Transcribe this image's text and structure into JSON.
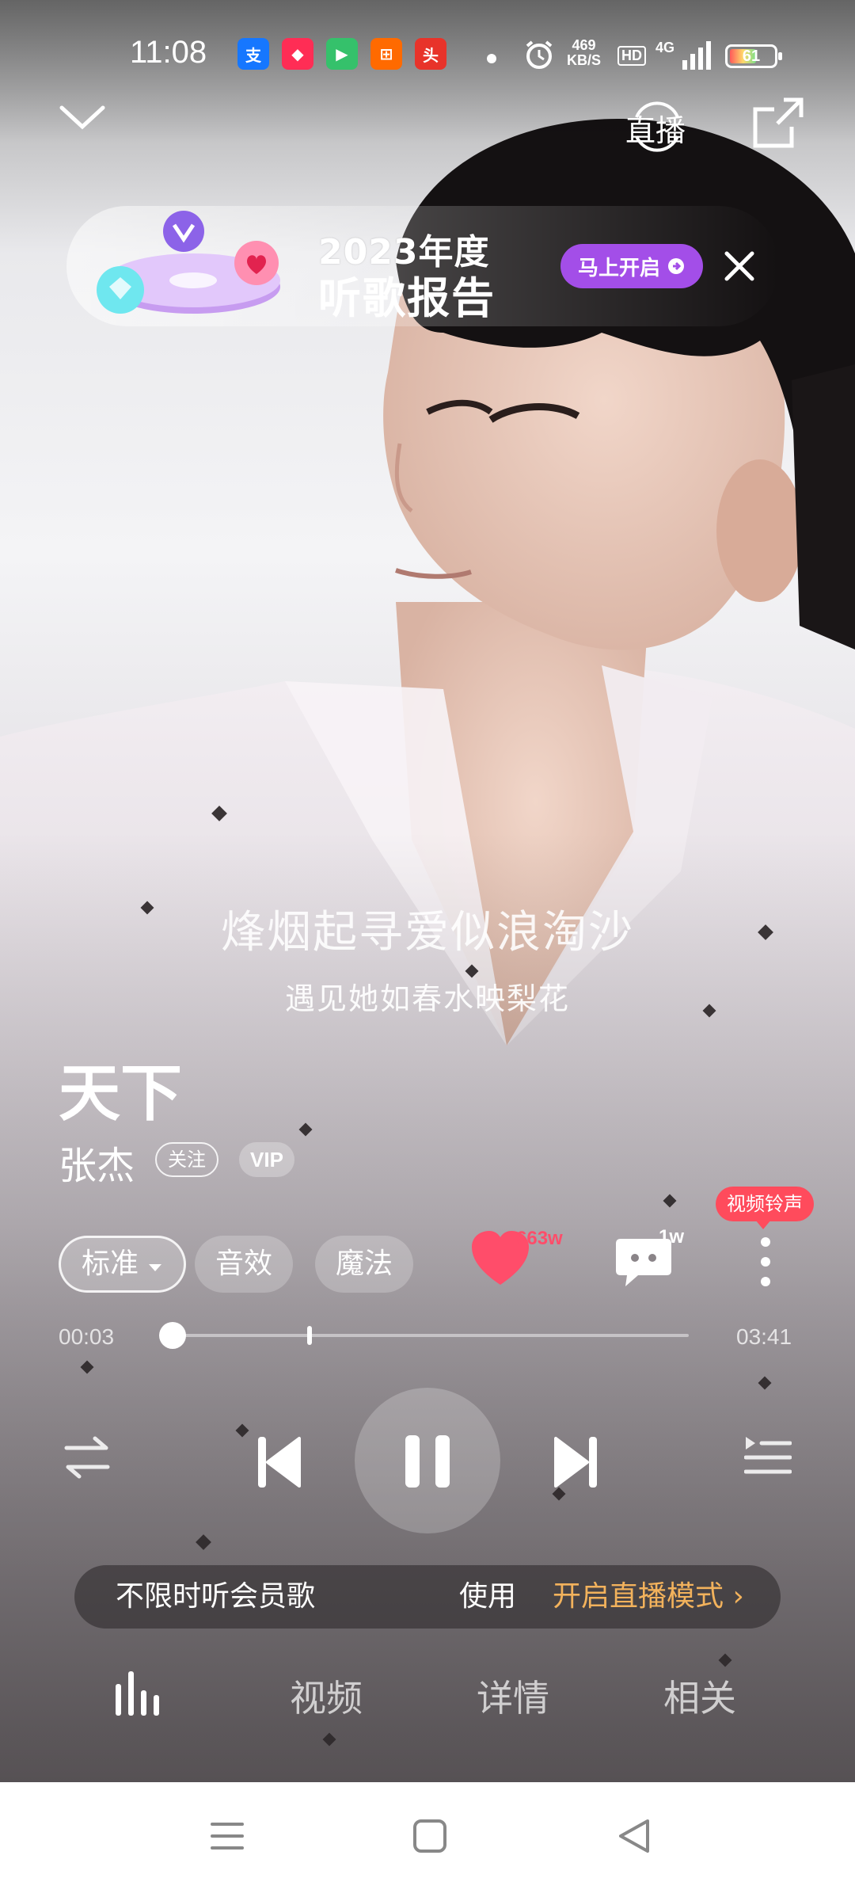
{
  "status_bar": {
    "time": "11:08",
    "net_speed_value": "469",
    "net_speed_unit": "KB/S",
    "hd": "HD",
    "network_type": "4G",
    "battery": "61",
    "battery_level": 0.61,
    "app_icons": [
      {
        "name": "alipay-icon",
        "color": "#1677ff",
        "glyph": "支"
      },
      {
        "name": "app-icon-2",
        "color": "#ff2d55",
        "glyph": "◆"
      },
      {
        "name": "app-icon-3",
        "color": "#35c16b",
        "glyph": "▶"
      },
      {
        "name": "app-icon-4",
        "color": "#ff6a00",
        "glyph": "⊞"
      },
      {
        "name": "toutiao-icon",
        "color": "#e8332a",
        "glyph": "头"
      }
    ]
  },
  "header": {
    "live_label": "直播"
  },
  "banner": {
    "year_text": "2023年度",
    "report_text": "听歌报告",
    "button_label": "马上开启"
  },
  "lyrics": {
    "current": "烽烟起寻爱似浪淘沙",
    "next": "遇见她如春水映梨花"
  },
  "song": {
    "title": "天下",
    "artist": "张杰",
    "follow_label": "关注",
    "vip_label": "VIP"
  },
  "options": {
    "quality_label": "标准",
    "effects_label": "音效",
    "magic_label": "魔法",
    "like_count": "663w",
    "comment_count": "1w",
    "ringtone_tag": "视频铃声"
  },
  "progress": {
    "current_time": "00:03",
    "total_time": "03:41",
    "played_fraction": 0.0,
    "marker_fraction": 0.26
  },
  "vip_strip": {
    "left_text": "不限时听会员歌",
    "middle_text": "使用",
    "right_text": "开启直播模式 ›"
  },
  "tabs": [
    "视频",
    "详情",
    "相关"
  ],
  "colors": {
    "like_red": "#ff4d6a",
    "ringtone_red": "#ff4b5c",
    "banner_purple": "#a34ee8",
    "strip_orange": "#f2b25c"
  }
}
